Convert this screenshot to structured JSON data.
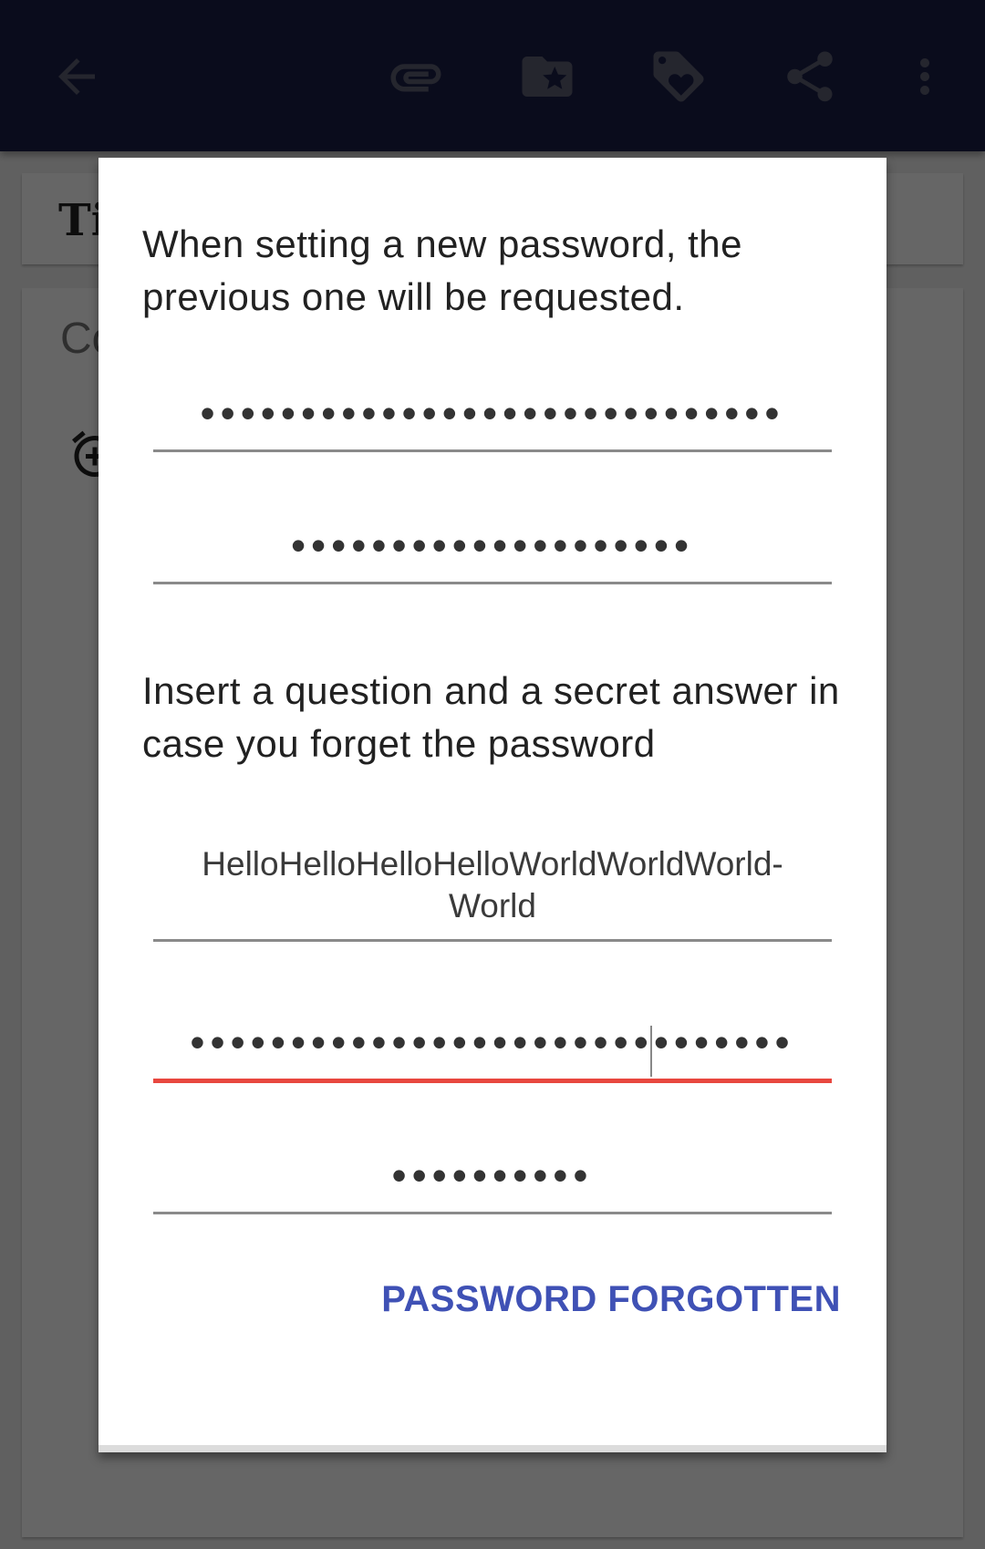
{
  "toolbar": {
    "icons": [
      "back-arrow-icon",
      "attachment-icon",
      "folder-star-icon",
      "tag-heart-icon",
      "share-icon",
      "more-vert-icon"
    ],
    "color": "#1a1f48"
  },
  "background": {
    "title_fragment": "Ti",
    "content_fragment": "Co"
  },
  "dialog": {
    "message_password": "When setting a new password, the previous one will be requested.",
    "old_password_mask": "•••••••••••••••••••••••••••••",
    "new_password_mask": "••••••••••••••••••••",
    "message_question": "Insert a question and a secret answer in case you forget the password",
    "question_value": "HelloHelloHelloHelloWorldWorldWorld-World",
    "answer_mask": "••••••••••••••••••••••••••••••",
    "answer_confirm_mask": "••••••••••",
    "forgot_button": "PASSWORD FORGOTTEN"
  },
  "colors": {
    "accent": "#3f51b5",
    "error_underline": "#e8473f"
  }
}
